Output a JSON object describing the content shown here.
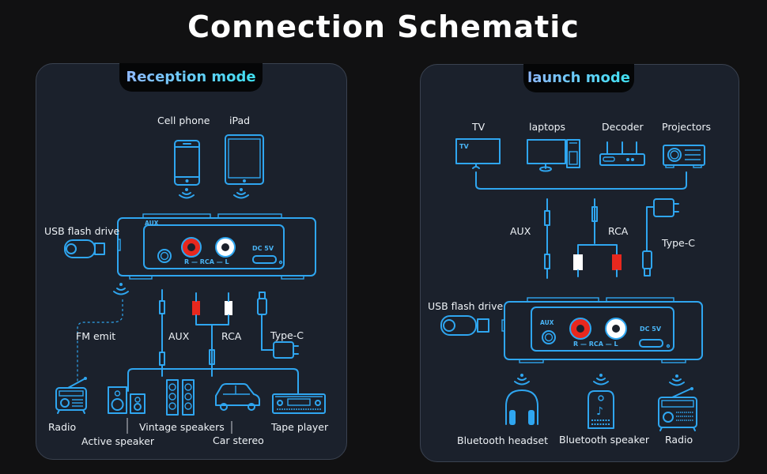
{
  "title": "Connection Schematic",
  "colors": {
    "accent": "#2fa6f0",
    "background": "#111112",
    "panel": "#1b212c",
    "rca_red": "#e8281e",
    "rca_white": "#ffffff"
  },
  "reception": {
    "tab": "Reception mode",
    "sources": [
      "Cell phone",
      "iPad"
    ],
    "usb": "USB flash drive",
    "fm": "FM emit",
    "cables": [
      "AUX",
      "RCA",
      "Type-C"
    ],
    "device": {
      "aux": "AUX",
      "rca": "R — RCA — L",
      "dc": "DC 5V"
    },
    "outputs": [
      "Radio",
      "Active speaker",
      "Vintage speakers",
      "Car stereo",
      "Tape player"
    ]
  },
  "launch": {
    "tab": "launch mode",
    "sources": [
      "TV",
      "laptops",
      "Decoder",
      "Projectors"
    ],
    "tv_screen": "TV",
    "cables": [
      "AUX",
      "RCA",
      "Type-C"
    ],
    "usb": "USB flash drive",
    "device": {
      "aux": "AUX",
      "rca": "R — RCA — L",
      "dc": "DC 5V"
    },
    "outputs": [
      "Bluetooth headset",
      "Bluetooth speaker",
      "Radio"
    ]
  }
}
